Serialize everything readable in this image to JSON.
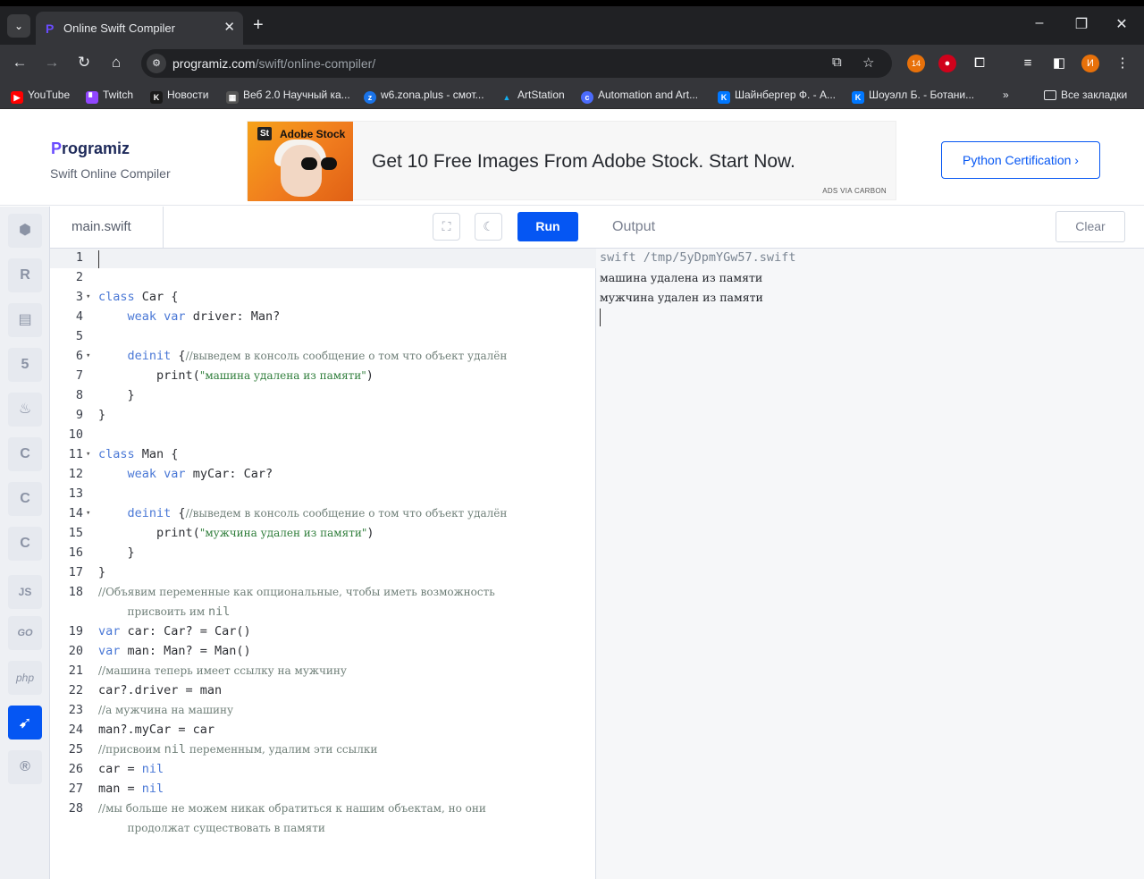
{
  "browser": {
    "tab_title": "Online Swift Compiler",
    "url_host": "programiz.com",
    "url_path": "/swift/online-compiler/",
    "ext_badge": "14",
    "profile_letter": "И",
    "bookmarks": [
      {
        "label": "YouTube",
        "icon": "youtube-icon",
        "color": "#ff0000"
      },
      {
        "label": "Twitch",
        "icon": "twitch-icon",
        "color": "#9146ff"
      },
      {
        "label": "Новости",
        "icon": "vk-icon",
        "color": "#0077ff"
      },
      {
        "label": "Веб 2.0 Научный ка...",
        "icon": "calc-icon",
        "color": "#666666"
      },
      {
        "label": "w6.zona.plus - смот...",
        "icon": "zona-icon",
        "color": "#1a73e8"
      },
      {
        "label": "ArtStation",
        "icon": "artstation-icon",
        "color": "#13aff0"
      },
      {
        "label": "Automation and Art...",
        "icon": "site-icon",
        "color": "#4b6bfb"
      },
      {
        "label": "Шайнбергер Ф. - А...",
        "icon": "vk-icon",
        "color": "#0077ff"
      },
      {
        "label": "Шоуэлл Б. - Ботани...",
        "icon": "vk-icon",
        "color": "#0077ff"
      }
    ],
    "more_bookmarks": "»",
    "all_bookmarks": "Все закладки"
  },
  "header": {
    "logo": "Programiz",
    "subtitle": "Swift Online Compiler",
    "ad_brand": "Adobe Stock",
    "ad_text": "Get 10 Free Images From Adobe Stock. Start Now.",
    "ad_credit": "ADS VIA CARBON",
    "cert_button": "Python Certification ›"
  },
  "sidebar": {
    "items": [
      "python-icon",
      "r-icon",
      "sql-icon",
      "html5-icon",
      "java-icon",
      "c-icon",
      "cpp-icon",
      "csharp-icon",
      "js-icon",
      "go-icon",
      "php-icon",
      "swift-icon",
      "rust-icon"
    ],
    "labels": {
      "js": "JS",
      "go": "GO",
      "php": "php"
    },
    "active": "swift-icon",
    "active_color": "#0556f3"
  },
  "editor": {
    "filename": "main.swift",
    "run_label": "Run",
    "lines": [
      "",
      "",
      "class Car {",
      "    weak var driver: Man?",
      "",
      "    deinit {//выведем в консоль сообщение о том что объект удалён",
      "        print(\"машина удалена из памяти\")",
      "    }",
      "}",
      "",
      "class Man {",
      "    weak var myCar: Car?",
      "",
      "    deinit {//выведем в консоль сообщение о том что объект удалён",
      "        print(\"мужчина удален из памяти\")",
      "    }",
      "}",
      "//Объявим переменные как опциональные, чтобы иметь возможность присвоить им nil",
      "var car: Car? = Car()",
      "var man: Man? = Man()",
      "//машина теперь имеет ссылку на мужчину",
      "car?.driver = man",
      "//а мужчина на машину",
      "man?.myCar = car",
      "//присвоим nil переменным, удалим эти ссылки",
      "car = nil",
      "man = nil",
      "//мы больше не можем никак обратиться к нашим объектам, но они продолжат существовать в памяти"
    ]
  },
  "output": {
    "title": "Output",
    "clear_label": "Clear",
    "lines": [
      "swift /tmp/5yDpmYGw57.swift",
      "машина удалена из памяти",
      "мужчина удален из памяти"
    ]
  }
}
